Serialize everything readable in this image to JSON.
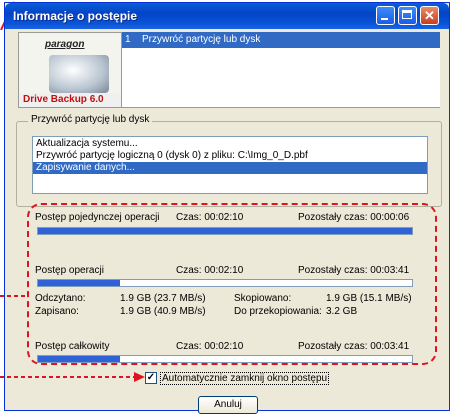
{
  "window": {
    "title": "Informacje o postępie"
  },
  "logo": {
    "brand": "paragon",
    "product": "Drive Backup 6.0"
  },
  "steps": {
    "number": "1",
    "label": "Przywróć partycję lub dysk"
  },
  "group": {
    "title": "Przywróć partycję lub dysk",
    "log": [
      "Aktualizacja systemu...",
      "Przywróć partycję logiczną 0 (dysk 0) z pliku: C:\\Img_0_D.pbf",
      "Zapisywanie danych..."
    ],
    "selected_index": 2
  },
  "progress": {
    "single": {
      "label": "Postęp pojedynczej operacji",
      "time": "Czas: 00:02:10",
      "remaining": "Pozostały czas: 00:00:06",
      "fraction": 1.0
    },
    "operation": {
      "label": "Postęp operacji",
      "time": "Czas: 00:02:10",
      "remaining": "Pozostały czas: 00:03:41",
      "fraction": 0.22
    },
    "total": {
      "label": "Postęp całkowity",
      "time": "Czas: 00:02:10",
      "remaining": "Pozostały czas: 00:03:41",
      "fraction": 0.22
    }
  },
  "stats": {
    "read_label": "Odczytano:",
    "read_value": "1.9 GB (23.7 MB/s)",
    "written_label": "Zapisano:",
    "written_value": "1.9 GB (40.9 MB/s)",
    "copied_label": "Skopiowano:",
    "copied_value": "1.9 GB (15.1 MB/s)",
    "tocopy_label": "Do przekopiowania:",
    "tocopy_value": "3.2 GB"
  },
  "auto_close": {
    "label": "Automatycznie zamknij okno postępu",
    "checked": true,
    "check_glyph": "✓"
  },
  "buttons": {
    "cancel": "Anuluj"
  },
  "colors": {
    "annotation": "#e0141e",
    "selection": "#316ac5",
    "progress": "#2f62d6"
  }
}
